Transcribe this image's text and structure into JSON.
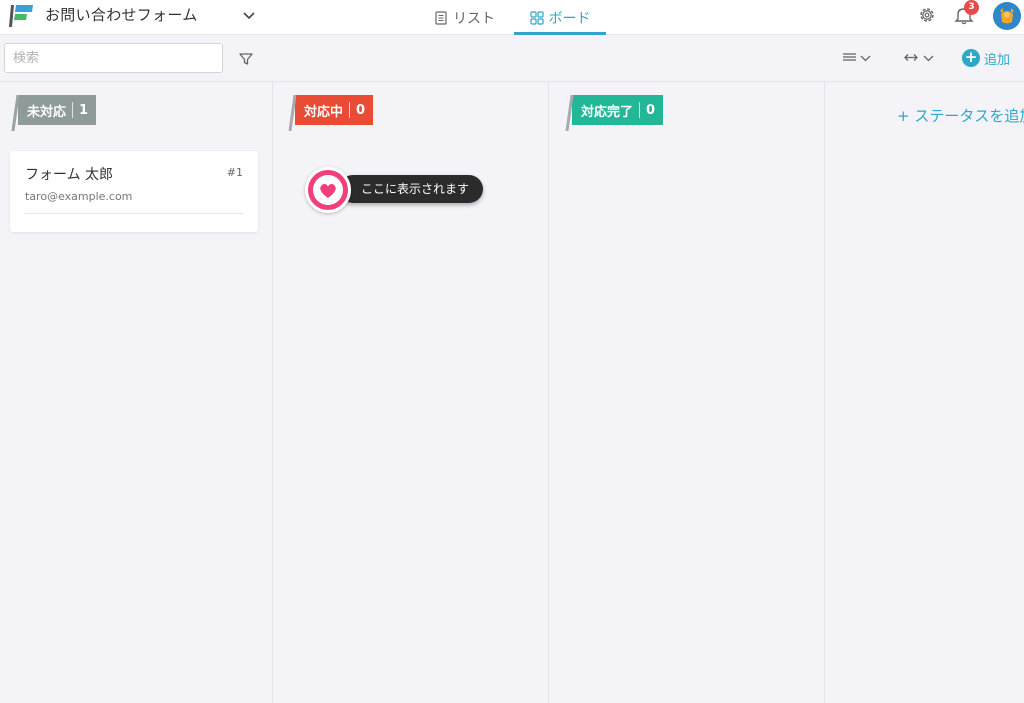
{
  "header": {
    "form_title": "お問い合わせフォーム",
    "tabs": [
      {
        "label": "リスト",
        "icon": "document-icon",
        "active": false
      },
      {
        "label": "ボード",
        "icon": "grid-icon",
        "active": true
      }
    ],
    "notification_count": "3",
    "accent_color": "#2ea7c9"
  },
  "toolbar": {
    "search_placeholder": "検索",
    "add_label": "追加"
  },
  "board": {
    "columns": [
      {
        "label": "未対応",
        "count": "1",
        "color": "#8f9b9b"
      },
      {
        "label": "対応中",
        "count": "0",
        "color": "#e84c35"
      },
      {
        "label": "対応完了",
        "count": "0",
        "color": "#23b797"
      }
    ],
    "add_status_label": "+ ステータスを追加",
    "cards": [
      {
        "name": "フォーム 太郎",
        "id": "#1",
        "email": "taro@example.com"
      }
    ]
  },
  "tooltip": {
    "text": "ここに表示されます",
    "icon": "heart-icon"
  }
}
